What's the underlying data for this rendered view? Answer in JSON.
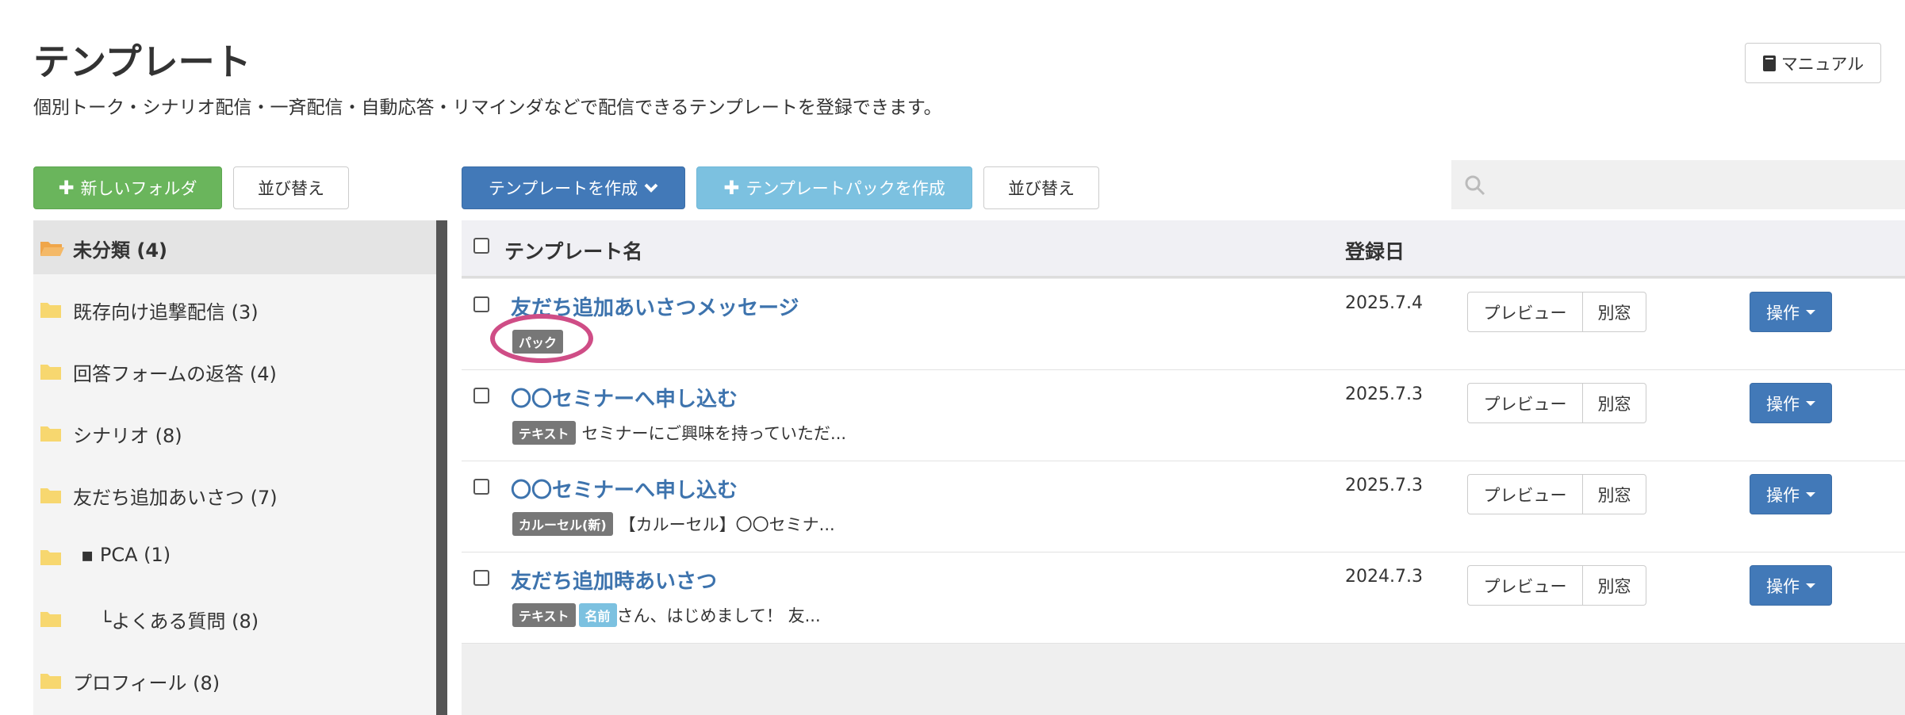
{
  "header": {
    "title": "テンプレート",
    "subtitle": "個別トーク・シナリオ配信・一斉配信・自動応答・リマインダなどで配信できるテンプレートを登録できます。",
    "manual_label": "マニュアル"
  },
  "toolbar": {
    "new_folder": "新しいフォルダ",
    "sort_folders": "並び替え",
    "create_template": "テンプレートを作成",
    "create_pack": "テンプレートパックを作成",
    "sort_templates": "並び替え"
  },
  "search": {
    "placeholder": ""
  },
  "sidebar": {
    "items": [
      {
        "label": "未分類 (4)",
        "active": true
      },
      {
        "label": "既存向け追撃配信 (3)"
      },
      {
        "label": "回答フォームの返答 (4)"
      },
      {
        "label": "シナリオ (8)"
      },
      {
        "label": "友だち追加あいさつ (7)"
      },
      {
        "label": "▪ PCA (1)"
      },
      {
        "label": "　└よくある質問 (8)"
      },
      {
        "label": "プロフィール (8)"
      }
    ]
  },
  "table": {
    "headers": {
      "name": "テンプレート名",
      "date": "登録日"
    },
    "rows": [
      {
        "name": "友だち追加あいさつメッセージ",
        "tag": "パック",
        "preview": "",
        "date": "2025.7.4"
      },
      {
        "name": "〇〇セミナーへ申し込む",
        "tag": "テキスト",
        "preview": "セミナーにご興味を持っていただ...",
        "date": "2025.7.3"
      },
      {
        "name": "〇〇セミナーへ申し込む",
        "tag": "カルーセル(新)",
        "preview": "【カルーセル】〇〇セミナ...",
        "date": "2025.7.3"
      },
      {
        "name": "友だち追加時あいさつ",
        "tag": "テキスト",
        "tag2": "名前",
        "preview": "さん、はじめまして！ 友...",
        "date": "2024.7.3"
      }
    ],
    "preview_label": "プレビュー",
    "window_label": "別窓",
    "action_label": "操作"
  },
  "colors": {
    "accent_blue": "#4279b8",
    "green": "#6ab55c",
    "light_blue": "#7cc1e0",
    "highlight": "#cf4d86"
  }
}
